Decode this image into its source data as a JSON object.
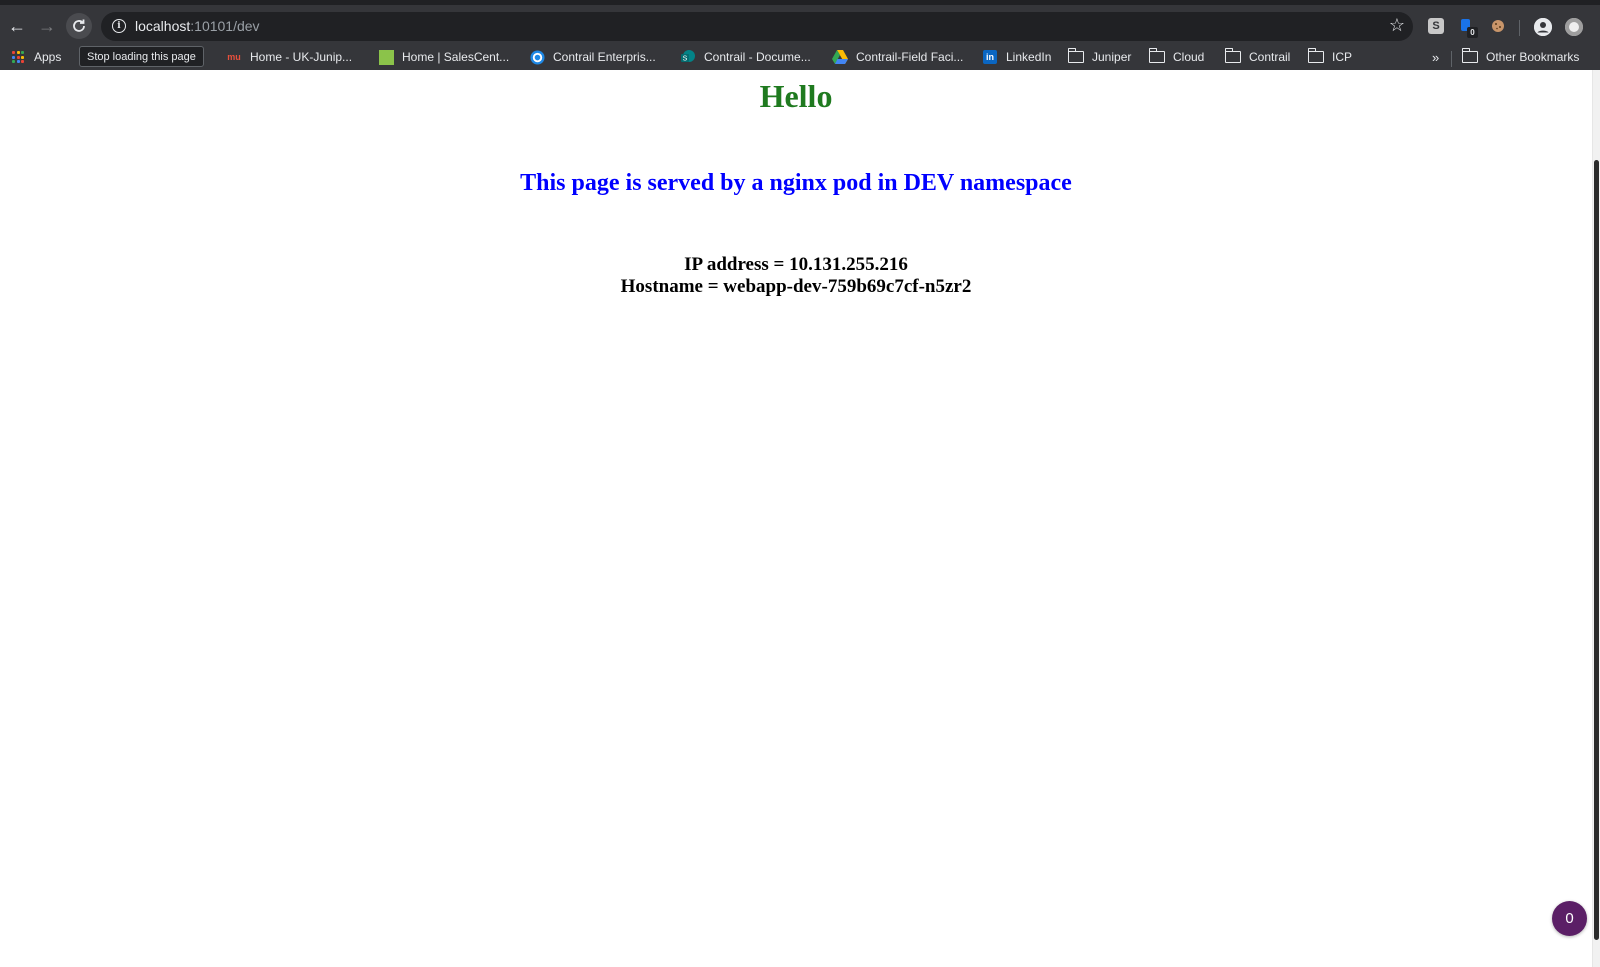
{
  "browser": {
    "url_host": "localhost",
    "url_rest": ":10101/dev",
    "reload_tooltip": "Stop loading this page",
    "extension_badge": "0"
  },
  "bookmarks": {
    "apps": "Apps",
    "items": [
      {
        "label": "Home - UK-Junip...",
        "icon": "mu-icon"
      },
      {
        "label": "Home | SalesCent...",
        "icon": "salescentral-icon"
      },
      {
        "label": "Contrail Enterpris...",
        "icon": "contrail-icon"
      },
      {
        "label": "Contrail - Docume...",
        "icon": "sharepoint-icon"
      },
      {
        "label": "Contrail-Field Faci...",
        "icon": "google-drive-icon"
      },
      {
        "label": "LinkedIn",
        "icon": "linkedin-icon"
      },
      {
        "label": "Juniper",
        "icon": "folder-icon"
      },
      {
        "label": "Cloud",
        "icon": "folder-icon"
      },
      {
        "label": "Contrail",
        "icon": "folder-icon"
      },
      {
        "label": "ICP",
        "icon": "folder-icon"
      }
    ],
    "overflow": "»",
    "other": "Other Bookmarks"
  },
  "page": {
    "heading": "Hello",
    "subheading": "This page is served by a nginx pod in DEV namespace",
    "ip_line": "IP address = 10.131.255.216",
    "hostname_line": "Hostname = webapp-dev-759b69c7cf-n5zr2"
  },
  "widget": {
    "count": "0"
  },
  "colors": {
    "heading": "#1f7a1f",
    "subheading": "#0000ff",
    "chrome": "#35363a",
    "widget": "#5b1f66"
  }
}
